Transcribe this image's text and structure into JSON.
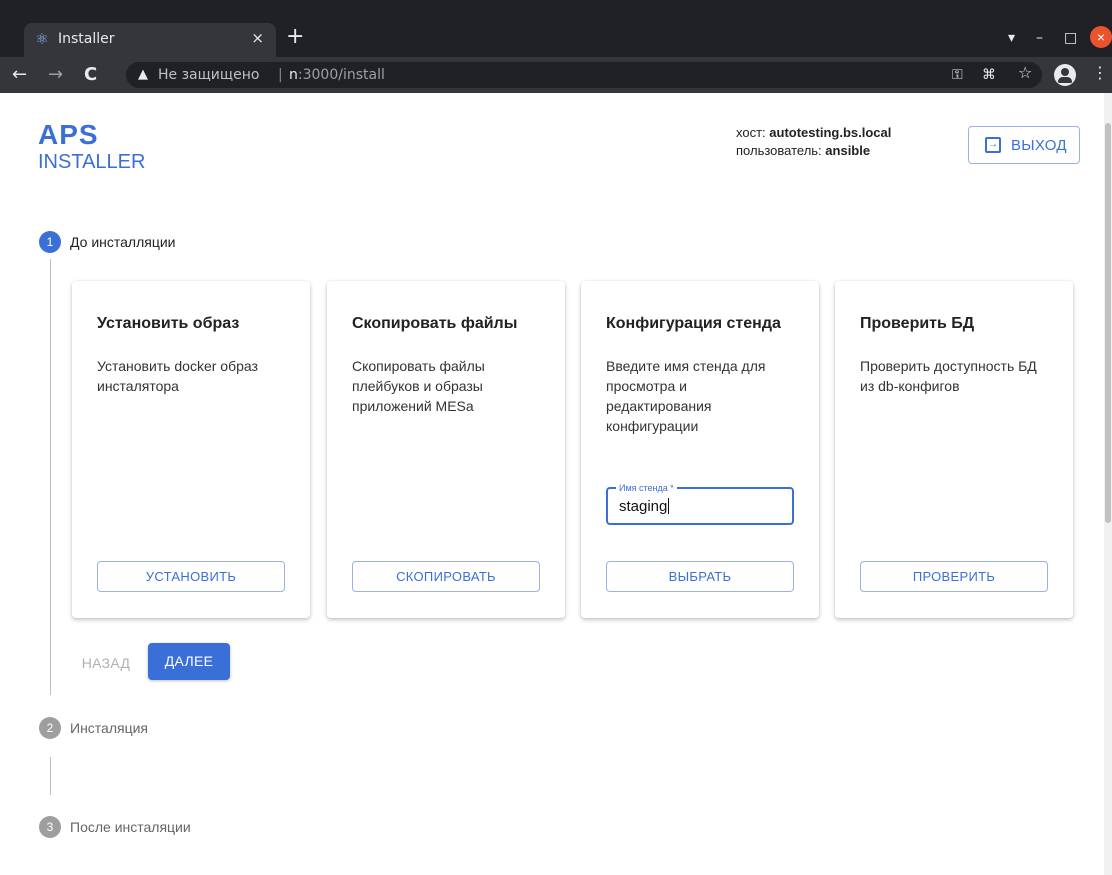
{
  "browser": {
    "tab_title": "Installer",
    "tab_close": "×",
    "new_tab": "+",
    "insecure_label": "Не защищено",
    "separator": "|",
    "url_host": "n",
    "url_rest": ":3000/install",
    "warning_glyph": "▲",
    "back_glyph": "←",
    "forward_glyph": "→",
    "reload_glyph": "C",
    "key_glyph": "⚿",
    "translate_glyph": "⌘",
    "star_glyph": "☆",
    "menu_glyph": "⋮",
    "extension_glyph": "▾",
    "minimize_glyph": "–",
    "maximize_glyph": "□",
    "close_glyph": "×"
  },
  "header": {
    "logo_line1": "APS",
    "logo_line2": "INSTALLER",
    "host_label": "хост:",
    "host_value": "autotesting.bs.local",
    "user_label": "пользователь:",
    "user_value": "ansible",
    "logout_label": "ВЫХОД",
    "logout_icon": "→"
  },
  "stepper": {
    "steps": [
      {
        "number": "1",
        "label": "До инсталляции",
        "active": true
      },
      {
        "number": "2",
        "label": "Инсталяция",
        "active": false
      },
      {
        "number": "3",
        "label": "После инсталяции",
        "active": false
      }
    ],
    "back_label": "НАЗАД",
    "next_label": "ДАЛЕЕ"
  },
  "cards": [
    {
      "title": "Установить образ",
      "description": "Установить docker образ инсталятора",
      "button": "УСТАНОВИТЬ"
    },
    {
      "title": "Скопировать файлы",
      "description": "Скопировать файлы плейбуков и образы приложений MESa",
      "button": "СКОПИРОВАТЬ"
    },
    {
      "title": "Конфигурация стенда",
      "description": "Введите имя стенда для просмотра и редактирования конфигурации",
      "button": "ВЫБРАТЬ",
      "field_label": "Имя стенда *",
      "field_value": "staging"
    },
    {
      "title": "Проверить БД",
      "description": "Проверить доступность БД из db-конфигов",
      "button": "ПРОВЕРИТЬ"
    }
  ],
  "colors": {
    "accent": "#3b6fd8",
    "inactive_step": "#9e9e9e",
    "chrome_dark": "#202124",
    "chrome_toolbar": "#35363a"
  }
}
